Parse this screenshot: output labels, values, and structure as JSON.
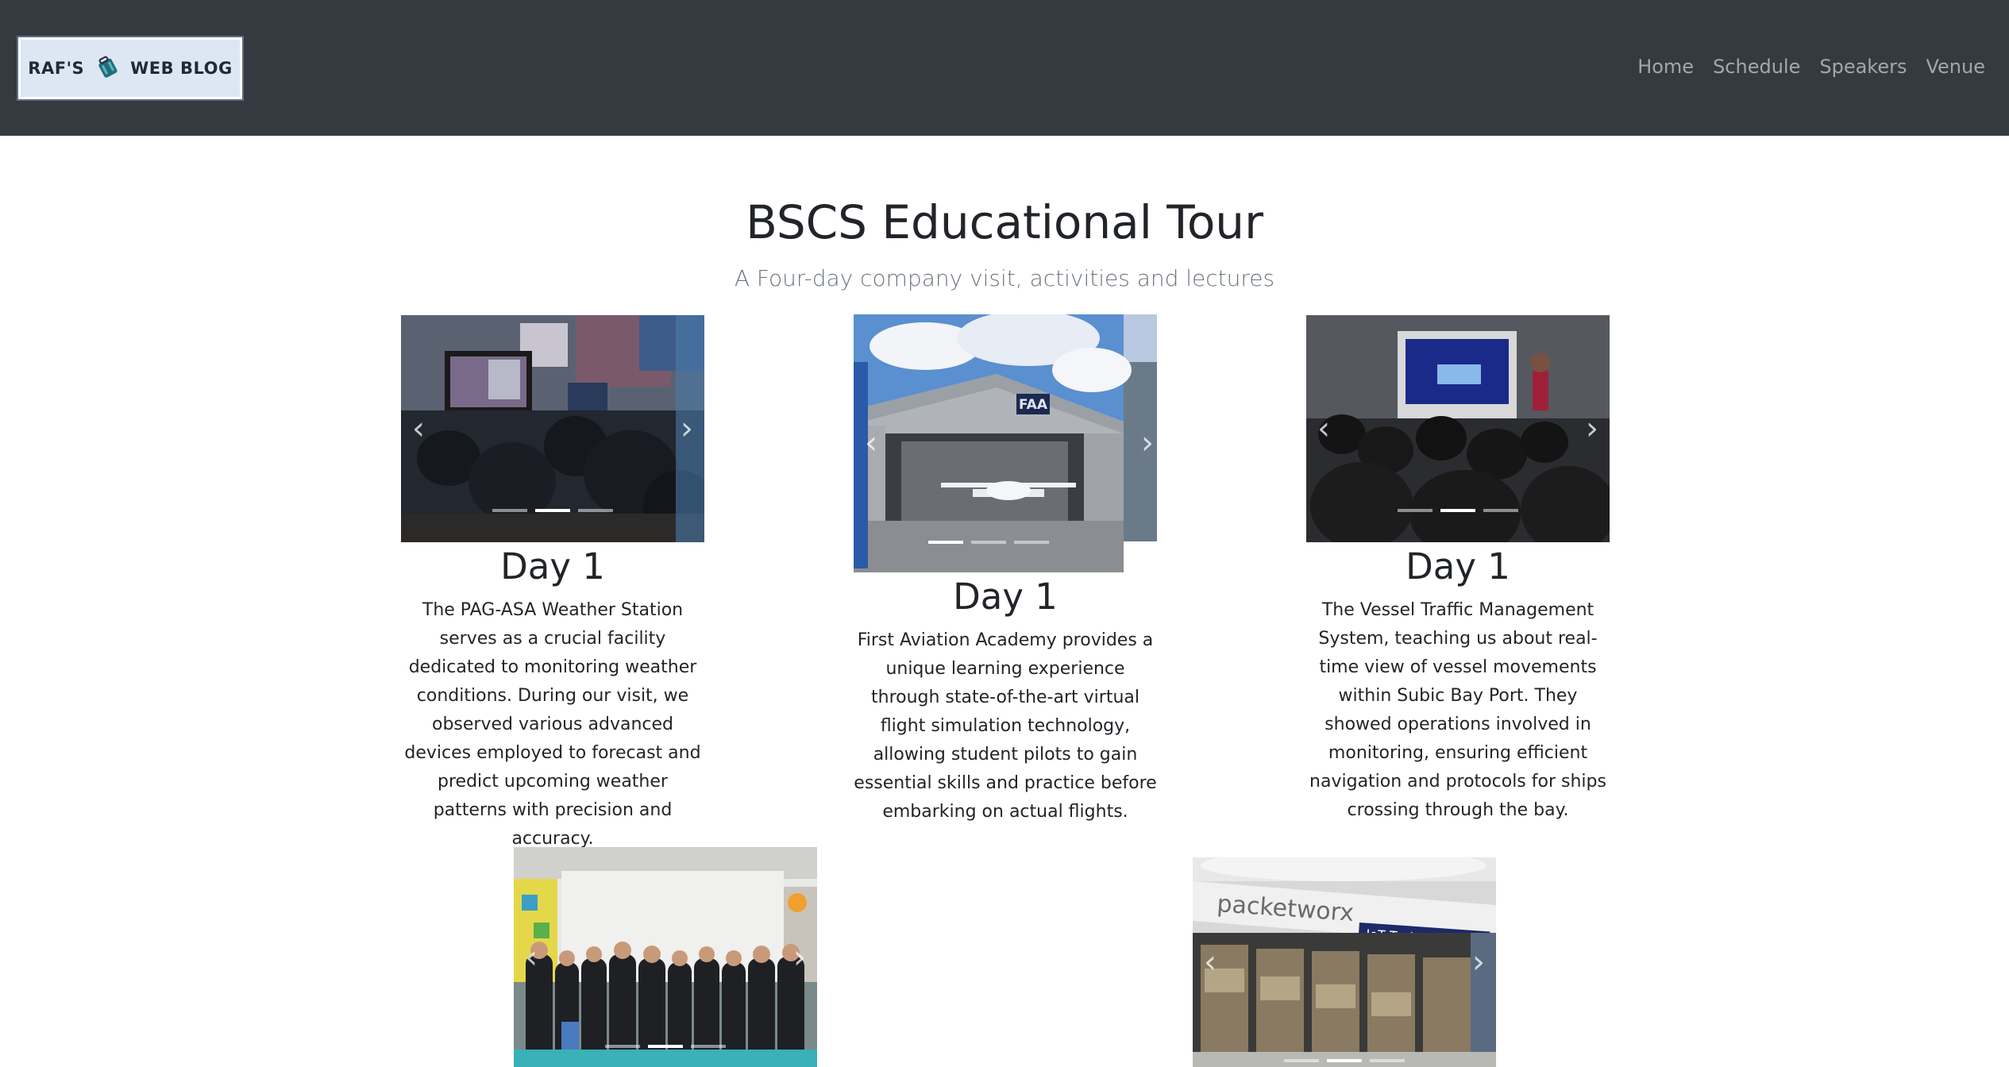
{
  "navbar": {
    "brand_left": "RAF'S",
    "brand_right": "WEB BLOG",
    "links": [
      "Home",
      "Schedule",
      "Speakers",
      "Venue"
    ]
  },
  "hero": {
    "title": "BSCS Educational Tour",
    "subtitle": "A Four-day company visit, activities and lectures"
  },
  "cards": [
    {
      "day": "Day 1",
      "description": "The PAG-ASA Weather Station serves as a crucial facility dedicated to monitoring weather conditions. During our visit, we observed various advanced devices employed to forecast and predict upcoming weather patterns with precision and accuracy.",
      "active_slide": 1
    },
    {
      "day": "Day 1",
      "description": "First Aviation Academy provides a unique learning experience through state-of-the-art virtual flight simulation technology, allowing student pilots to gain essential skills and practice before embarking on actual flights.",
      "active_slide": 0
    },
    {
      "day": "Day 1",
      "description": "The Vessel Traffic Management System, teaching us about real-time view of vessel movements within Subic Bay Port. They showed operations involved in monitoring, ensuring efficient navigation and protocols for ships crossing through the bay.",
      "active_slide": 1
    },
    {
      "active_slide": 1
    },
    {
      "active_slide": 1
    }
  ],
  "photo_signs": {
    "hangar_sign": "FAA",
    "store_brand": "packetworx",
    "store_sign": "IoT Technology Hub"
  },
  "colors": {
    "navbar_bg": "#343a40",
    "brand_bg": "#dce7f3",
    "nav_link": "rgba(255,255,255,0.55)",
    "text": "#212529",
    "muted": "#6c757d"
  }
}
